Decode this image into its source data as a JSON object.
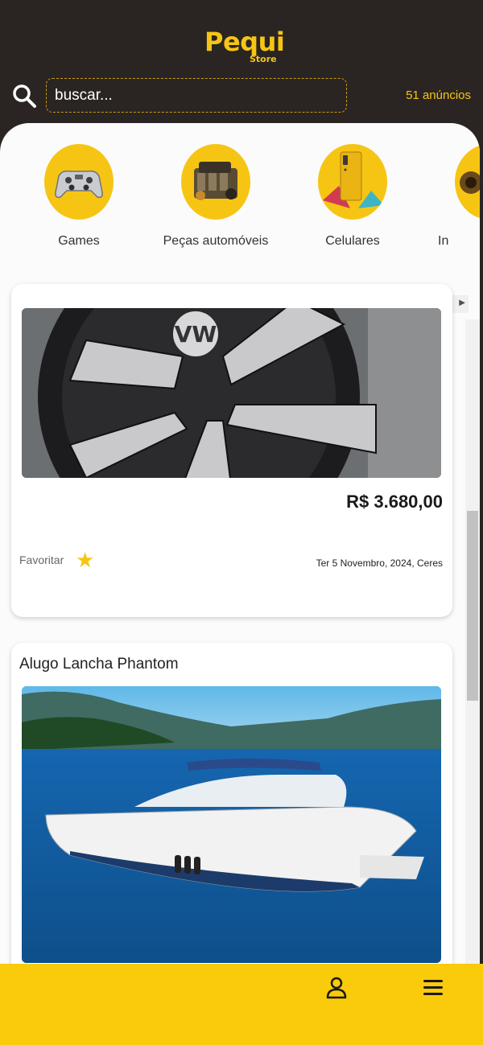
{
  "header": {
    "logo_main": "Pequi",
    "logo_sub": "Store",
    "search_placeholder": "buscar...",
    "ad_count": "51 anúncios"
  },
  "categories": [
    {
      "label": "Games",
      "icon": "gamepad-icon"
    },
    {
      "label": "Peças automóveis",
      "icon": "engine-icon"
    },
    {
      "label": "Celulares",
      "icon": "smartphone-icon"
    },
    {
      "label": "In",
      "icon": "category-icon"
    }
  ],
  "listings": [
    {
      "title": "",
      "image": "car-wheel-image",
      "price": "R$ 3.680,00",
      "favorite_label": "Favoritar",
      "date_location": "Ter 5 Novembro, 2024, Ceres"
    },
    {
      "title": "Alugo Lancha Phantom",
      "image": "speedboat-image"
    }
  ],
  "colors": {
    "brand_yellow": "#f6c514",
    "header_dark": "#2a2522",
    "bottom_bar": "#f9cb0a"
  },
  "bottom_nav": {
    "user_icon": "user-icon",
    "menu_icon": "menu-icon"
  }
}
